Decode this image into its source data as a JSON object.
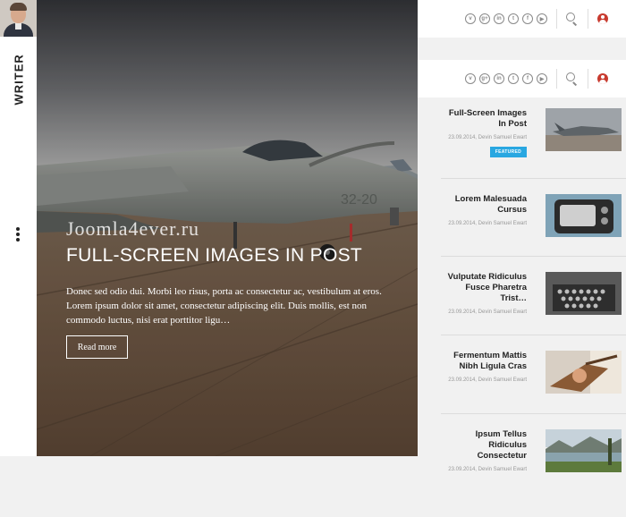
{
  "sidebar": {
    "title": "WRITER"
  },
  "hero": {
    "watermark": "Joomla4ever.ru",
    "title": "FULL-SCREEN IMAGES IN POST",
    "excerpt": "Donec sed odio dui. Morbi leo risus, porta ac consectetur ac, vestibulum at eros. Lorem ipsum dolor sit amet, consectetur adipiscing elit. Duis mollis, est non commodo luctus, nisi erat porttitor ligu…",
    "button": "Read more"
  },
  "header": {
    "social": [
      {
        "name": "vimeo-icon",
        "glyph": "v"
      },
      {
        "name": "google-plus-icon",
        "glyph": "g+"
      },
      {
        "name": "linkedin-icon",
        "glyph": "in"
      },
      {
        "name": "twitter-icon",
        "glyph": "t"
      },
      {
        "name": "facebook-icon",
        "glyph": "f"
      },
      {
        "name": "youtube-icon",
        "glyph": "▶"
      }
    ]
  },
  "articles": [
    {
      "title": "Full-Screen Images In Post",
      "meta": "23.09.2014, Devin Samuel Ewart",
      "badge": "FEATURED",
      "thumb": "jet"
    },
    {
      "title": "Lorem Malesuada Cursus",
      "meta": "23.09.2014, Devin Samuel Ewart",
      "badge": "",
      "thumb": "radio"
    },
    {
      "title": "Vulputate Ridiculus Fusce Pharetra Trist…",
      "meta": "23.09.2014, Devin Samuel Ewart",
      "badge": "",
      "thumb": "typewriter"
    },
    {
      "title": "Fermentum Mattis Nibh Ligula Cras",
      "meta": "23.09.2014, Devin Samuel Ewart",
      "badge": "",
      "thumb": "guitar"
    },
    {
      "title": "Ipsum Tellus Ridiculus Consectetur",
      "meta": "23.09.2014, Devin Samuel Ewart",
      "badge": "",
      "thumb": "lake"
    }
  ],
  "colors": {
    "accent": "#29a7e1",
    "user_icon": "#c83a2e"
  }
}
